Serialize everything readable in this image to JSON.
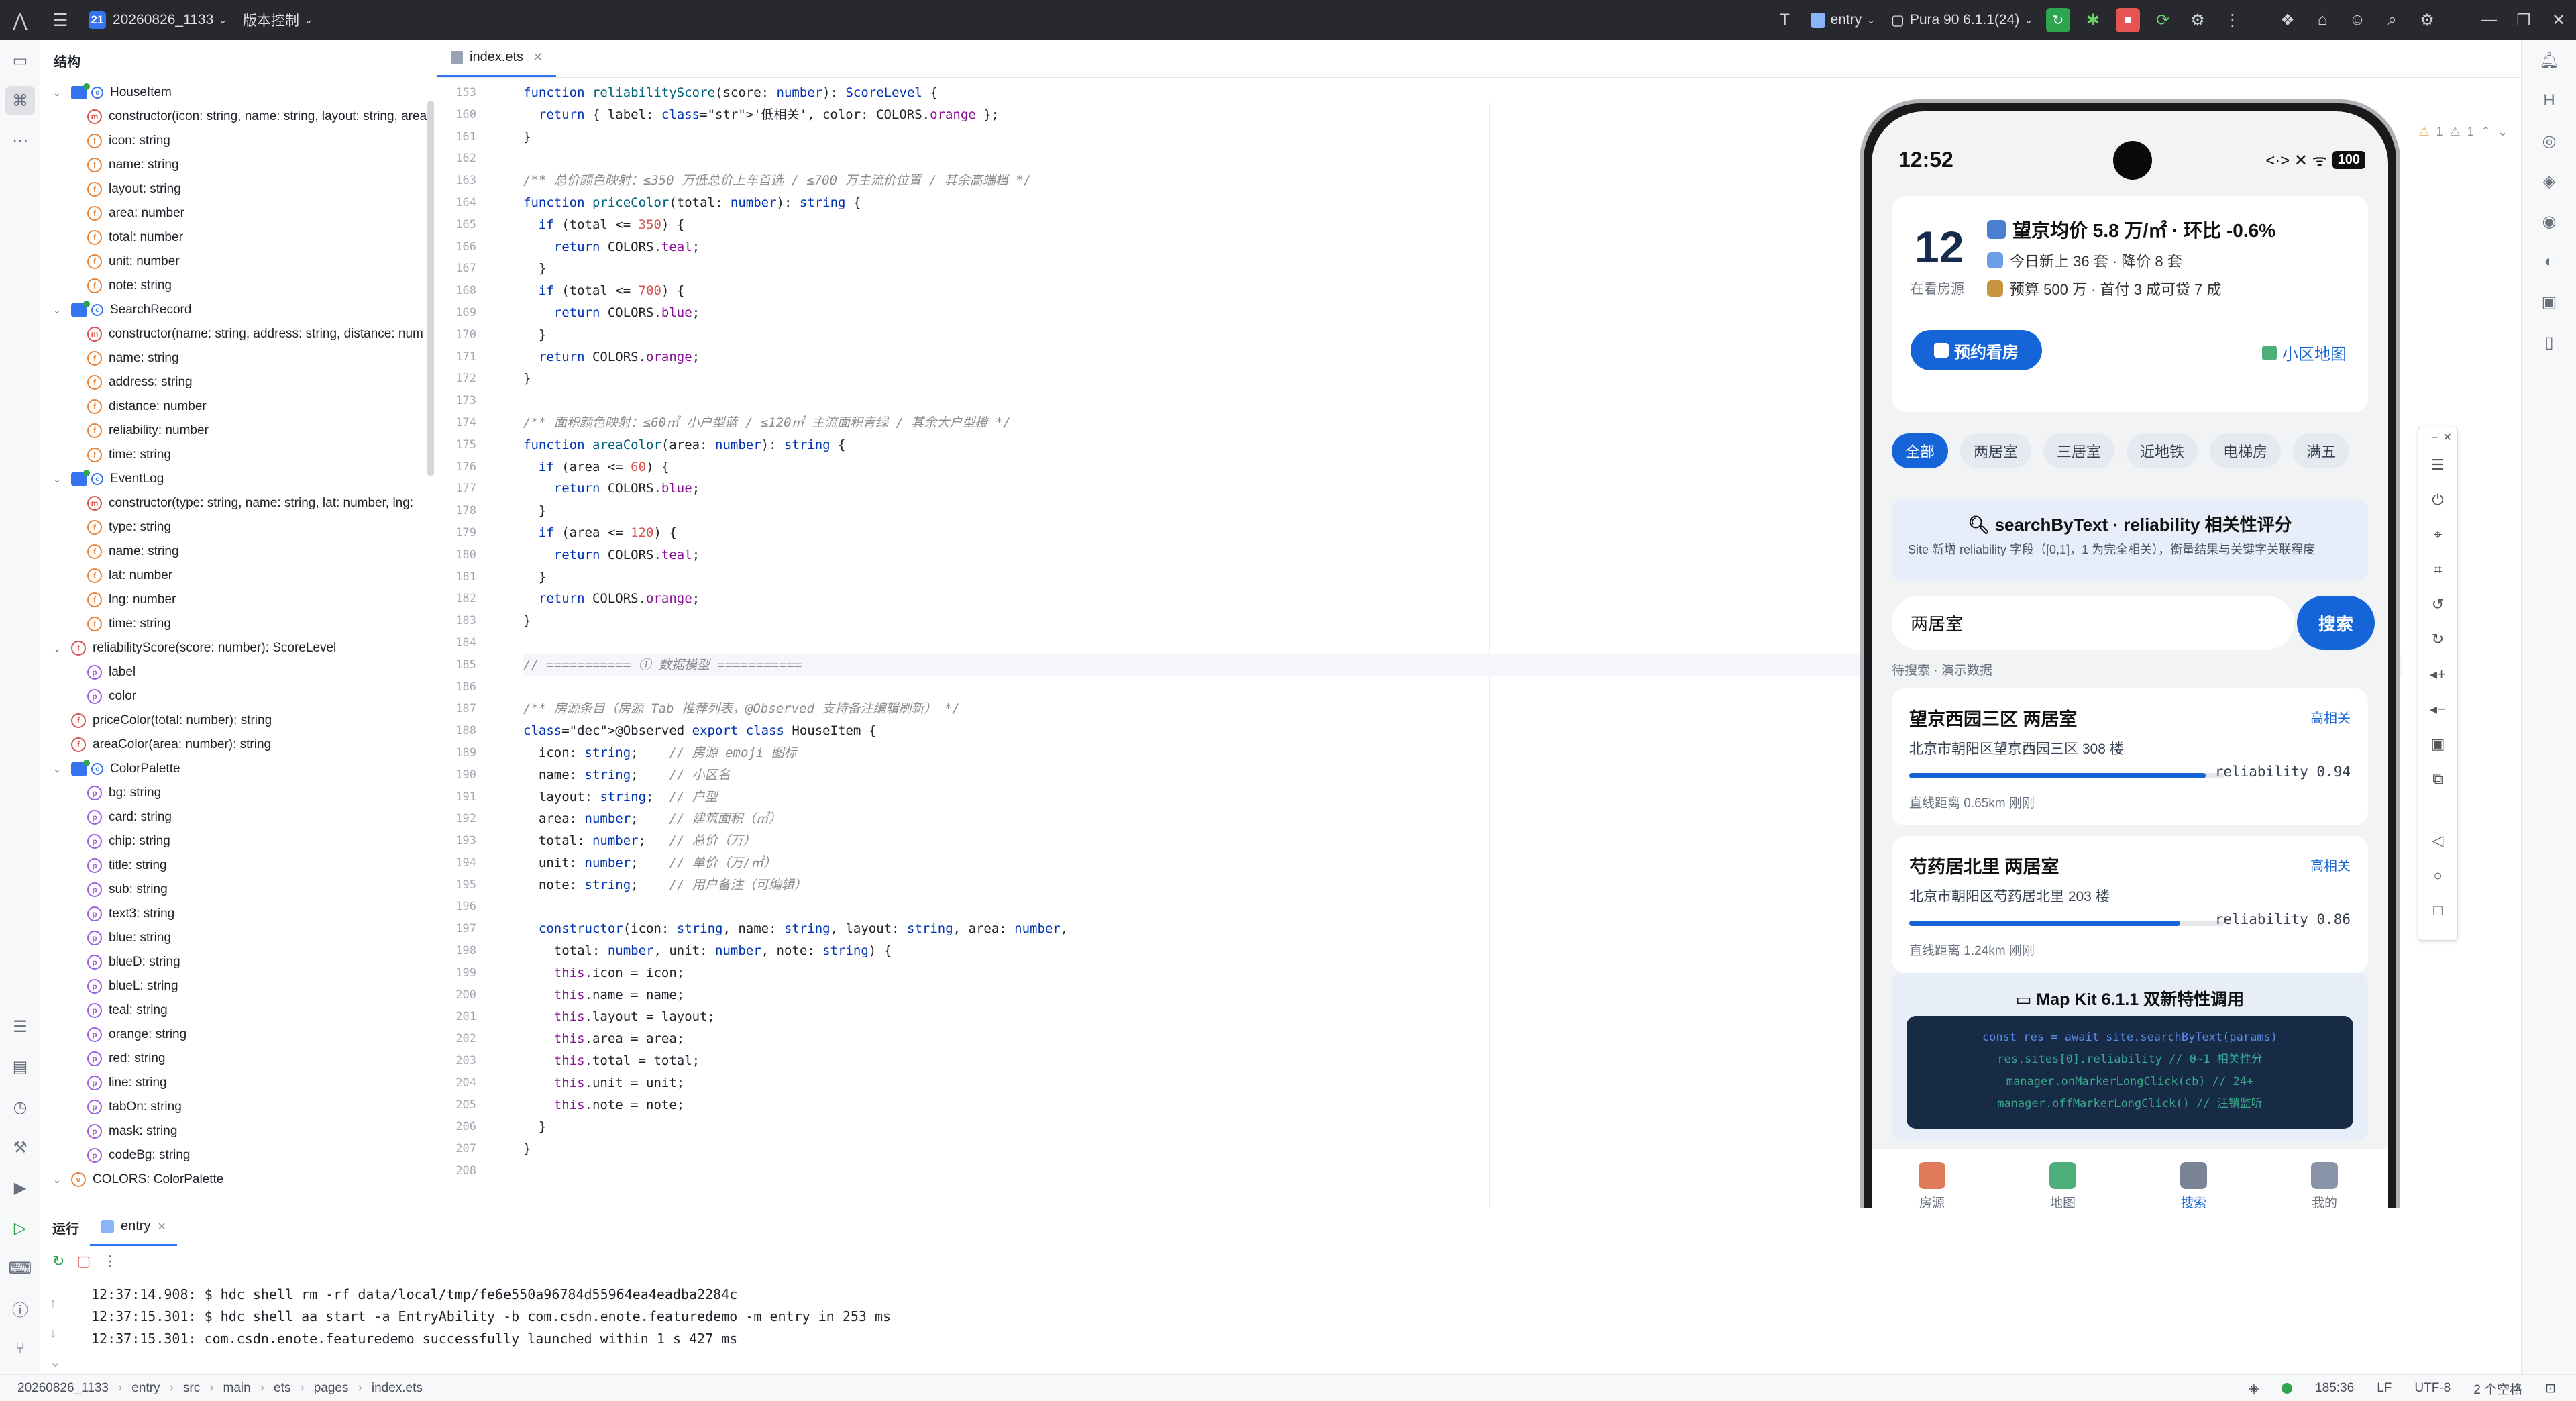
{
  "titlebar": {
    "project_badge": "21",
    "project_name": "20260826_1133",
    "vcs_label": "版本控制",
    "run_config": "entry",
    "device": "Pura 90 6.1.1(24)"
  },
  "structure": {
    "title": "结构",
    "rows": [
      {
        "level": 0,
        "kind": "class",
        "expand": "v",
        "text": "HouseItem"
      },
      {
        "level": 1,
        "kind": "m",
        "text": "constructor(icon: string, name: string, layout: string, area"
      },
      {
        "level": 1,
        "kind": "f",
        "text": "icon: string"
      },
      {
        "level": 1,
        "kind": "f",
        "text": "name: string"
      },
      {
        "level": 1,
        "kind": "f",
        "text": "layout: string"
      },
      {
        "level": 1,
        "kind": "f",
        "text": "area: number"
      },
      {
        "level": 1,
        "kind": "f",
        "text": "total: number"
      },
      {
        "level": 1,
        "kind": "f",
        "text": "unit: number"
      },
      {
        "level": 1,
        "kind": "f",
        "text": "note: string"
      },
      {
        "level": 0,
        "kind": "class",
        "expand": "v",
        "text": "SearchRecord"
      },
      {
        "level": 1,
        "kind": "m",
        "text": "constructor(name: string, address: string, distance: num"
      },
      {
        "level": 1,
        "kind": "f",
        "text": "name: string"
      },
      {
        "level": 1,
        "kind": "f",
        "text": "address: string"
      },
      {
        "level": 1,
        "kind": "f",
        "text": "distance: number"
      },
      {
        "level": 1,
        "kind": "f",
        "text": "reliability: number"
      },
      {
        "level": 1,
        "kind": "f",
        "text": "time: string"
      },
      {
        "level": 0,
        "kind": "class",
        "expand": "v",
        "text": "EventLog"
      },
      {
        "level": 1,
        "kind": "m",
        "text": "constructor(type: string, name: string, lat: number, lng:"
      },
      {
        "level": 1,
        "kind": "f",
        "text": "type: string"
      },
      {
        "level": 1,
        "kind": "f",
        "text": "name: string"
      },
      {
        "level": 1,
        "kind": "f",
        "text": "lat: number"
      },
      {
        "level": 1,
        "kind": "f",
        "text": "lng: number"
      },
      {
        "level": 1,
        "kind": "f",
        "text": "time: string"
      },
      {
        "level": 0,
        "kind": "fn",
        "expand": "v",
        "text": "reliabilityScore(score: number): ScoreLevel"
      },
      {
        "level": 1,
        "kind": "p",
        "text": "label"
      },
      {
        "level": 1,
        "kind": "p",
        "text": "color"
      },
      {
        "level": 0,
        "kind": "fn",
        "expand": "",
        "text": "priceColor(total: number): string"
      },
      {
        "level": 0,
        "kind": "fn",
        "expand": "",
        "text": "areaColor(area: number): string"
      },
      {
        "level": 0,
        "kind": "class",
        "expand": "v",
        "text": "ColorPalette"
      },
      {
        "level": 1,
        "kind": "p",
        "text": "bg: string"
      },
      {
        "level": 1,
        "kind": "p",
        "text": "card: string"
      },
      {
        "level": 1,
        "kind": "p",
        "text": "chip: string"
      },
      {
        "level": 1,
        "kind": "p",
        "text": "title: string"
      },
      {
        "level": 1,
        "kind": "p",
        "text": "sub: string"
      },
      {
        "level": 1,
        "kind": "p",
        "text": "text3: string"
      },
      {
        "level": 1,
        "kind": "p",
        "text": "blue: string"
      },
      {
        "level": 1,
        "kind": "p",
        "text": "blueD: string"
      },
      {
        "level": 1,
        "kind": "p",
        "text": "blueL: string"
      },
      {
        "level": 1,
        "kind": "p",
        "text": "teal: string"
      },
      {
        "level": 1,
        "kind": "p",
        "text": "orange: string"
      },
      {
        "level": 1,
        "kind": "p",
        "text": "red: string"
      },
      {
        "level": 1,
        "kind": "p",
        "text": "line: string"
      },
      {
        "level": 1,
        "kind": "p",
        "text": "tabOn: string"
      },
      {
        "level": 1,
        "kind": "p",
        "text": "mask: string"
      },
      {
        "level": 1,
        "kind": "p",
        "text": "codeBg: string"
      },
      {
        "level": 0,
        "kind": "const",
        "expand": "v",
        "text": "COLORS: ColorPalette"
      }
    ]
  },
  "editor": {
    "tab_name": "index.ets",
    "warn_count": "1",
    "weak_count": "1",
    "lines": [
      {
        "n": "153",
        "t": "function reliabilityScore(score: number): ScoreLevel {"
      },
      {
        "n": "160",
        "t": "  return { label: '低相关', color: COLORS.orange };"
      },
      {
        "n": "161",
        "t": "}"
      },
      {
        "n": "162",
        "t": ""
      },
      {
        "n": "163",
        "t": "/** 总价颜色映射：≤350 万低总价上车首选 / ≤700 万主流价位置 / 其余高端档 */"
      },
      {
        "n": "164",
        "t": "function priceColor(total: number): string {"
      },
      {
        "n": "165",
        "t": "  if (total <= 350) {"
      },
      {
        "n": "166",
        "t": "    return COLORS.teal;"
      },
      {
        "n": "167",
        "t": "  }"
      },
      {
        "n": "168",
        "t": "  if (total <= 700) {"
      },
      {
        "n": "169",
        "t": "    return COLORS.blue;"
      },
      {
        "n": "170",
        "t": "  }"
      },
      {
        "n": "171",
        "t": "  return COLORS.orange;"
      },
      {
        "n": "172",
        "t": "}"
      },
      {
        "n": "173",
        "t": ""
      },
      {
        "n": "174",
        "t": "/** 面积颜色映射：≤60㎡ 小户型蓝 / ≤120㎡ 主流面积青绿 / 其余大户型橙 */"
      },
      {
        "n": "175",
        "t": "function areaColor(area: number): string {"
      },
      {
        "n": "176",
        "t": "  if (area <= 60) {"
      },
      {
        "n": "177",
        "t": "    return COLORS.blue;"
      },
      {
        "n": "178",
        "t": "  }"
      },
      {
        "n": "179",
        "t": "  if (area <= 120) {"
      },
      {
        "n": "180",
        "t": "    return COLORS.teal;"
      },
      {
        "n": "181",
        "t": "  }"
      },
      {
        "n": "182",
        "t": "  return COLORS.orange;"
      },
      {
        "n": "183",
        "t": "}"
      },
      {
        "n": "184",
        "t": ""
      },
      {
        "n": "185",
        "t": "// =========== ① 数据模型 ==========="
      },
      {
        "n": "186",
        "t": ""
      },
      {
        "n": "187",
        "t": "/** 房源条目（房源 Tab 推荐列表，@Observed 支持备注编辑刷新） */"
      },
      {
        "n": "188",
        "t": "@Observed export class HouseItem {"
      },
      {
        "n": "189",
        "t": "  icon: string;    // 房源 emoji 图标"
      },
      {
        "n": "190",
        "t": "  name: string;    // 小区名"
      },
      {
        "n": "191",
        "t": "  layout: string;  // 户型"
      },
      {
        "n": "192",
        "t": "  area: number;    // 建筑面积（㎡）"
      },
      {
        "n": "193",
        "t": "  total: number;   // 总价（万）"
      },
      {
        "n": "194",
        "t": "  unit: number;    // 单价（万/㎡）"
      },
      {
        "n": "195",
        "t": "  note: string;    // 用户备注（可编辑）"
      },
      {
        "n": "196",
        "t": ""
      },
      {
        "n": "197",
        "t": "  constructor(icon: string, name: string, layout: string, area: number,"
      },
      {
        "n": "198",
        "t": "    total: number, unit: number, note: string) {"
      },
      {
        "n": "199",
        "t": "    this.icon = icon;"
      },
      {
        "n": "200",
        "t": "    this.name = name;"
      },
      {
        "n": "201",
        "t": "    this.layout = layout;"
      },
      {
        "n": "202",
        "t": "    this.area = area;"
      },
      {
        "n": "203",
        "t": "    this.total = total;"
      },
      {
        "n": "204",
        "t": "    this.unit = unit;"
      },
      {
        "n": "205",
        "t": "    this.note = note;"
      },
      {
        "n": "206",
        "t": "  }"
      },
      {
        "n": "207",
        "t": "}"
      },
      {
        "n": "208",
        "t": ""
      }
    ]
  },
  "phone": {
    "time": "12:52",
    "signal": "<·> ✕ ᯤ",
    "battery": "100",
    "hero": {
      "count": "12",
      "count_label": "在看房源",
      "line1": "望京均价 5.8 万/㎡ · 环比 -0.6%",
      "line2": "今日新上 36 套 · 降价 8 套",
      "line3": "预算 500 万 · 首付 3 成可贷 7 成",
      "button": "预约看房",
      "link": "小区地图"
    },
    "chips": [
      "全部",
      "两居室",
      "三居室",
      "近地铁",
      "电梯房",
      "满五"
    ],
    "search_card": {
      "title": "searchByText · reliability 相关性评分",
      "desc": "Site 新增 reliability 字段（[0,1]，1 为完全相关），衡量结果与关键字关联程度"
    },
    "search_input": "两居室",
    "search_button": "搜索",
    "search_state": "待搜索 · 演示数据",
    "results": [
      {
        "title": "望京西园三区 两居室",
        "tag": "高相关",
        "addr": "北京市朝阳区望京西园三区 308 楼",
        "reliability": 0.94,
        "rel_text": "reliability 0.94",
        "foot": "直线距离 0.65km    刚刚"
      },
      {
        "title": "芍药居北里 两居室",
        "tag": "高相关",
        "addr": "北京市朝阳区芍药居北里 203 楼",
        "reliability": 0.86,
        "rel_text": "reliability 0.86",
        "foot": "直线距离 1.24km    刚刚"
      }
    ],
    "mapkit": {
      "title": "Map Kit 6.1.1 双新特性调用",
      "code": [
        "const res = await site.searchByText(params)",
        "res.sites[0].reliability // 0~1 相关性分",
        "manager.onMarkerLongClick(cb) // 24+",
        "manager.offMarkerLongClick() // 注销监听"
      ]
    },
    "nav": [
      {
        "label": "房源",
        "on": false
      },
      {
        "label": "地图",
        "on": false
      },
      {
        "label": "搜索",
        "on": true
      },
      {
        "label": "我的",
        "on": false
      }
    ]
  },
  "run": {
    "title": "运行",
    "tab": "entry",
    "console": [
      "12:37:14.908: $ hdc shell rm -rf data/local/tmp/fe6e550a96784d55964ea4eadba2284c",
      "12:37:15.301: $ hdc shell aa start -a EntryAbility -b com.csdn.enote.featuredemo -m entry in 253 ms",
      "12:37:15.301: com.csdn.enote.featuredemo successfully launched within 1 s 427 ms"
    ]
  },
  "statusbar": {
    "crumbs": [
      "20260826_1133",
      "entry",
      "src",
      "main",
      "ets",
      "pages",
      "index.ets"
    ],
    "position": "185:36",
    "line_sep": "LF",
    "encoding": "UTF-8",
    "indent": "2 个空格"
  },
  "colors": {
    "accent": "#3574f0",
    "phone_primary": "#1565d8",
    "titlebar": "#27292e"
  }
}
